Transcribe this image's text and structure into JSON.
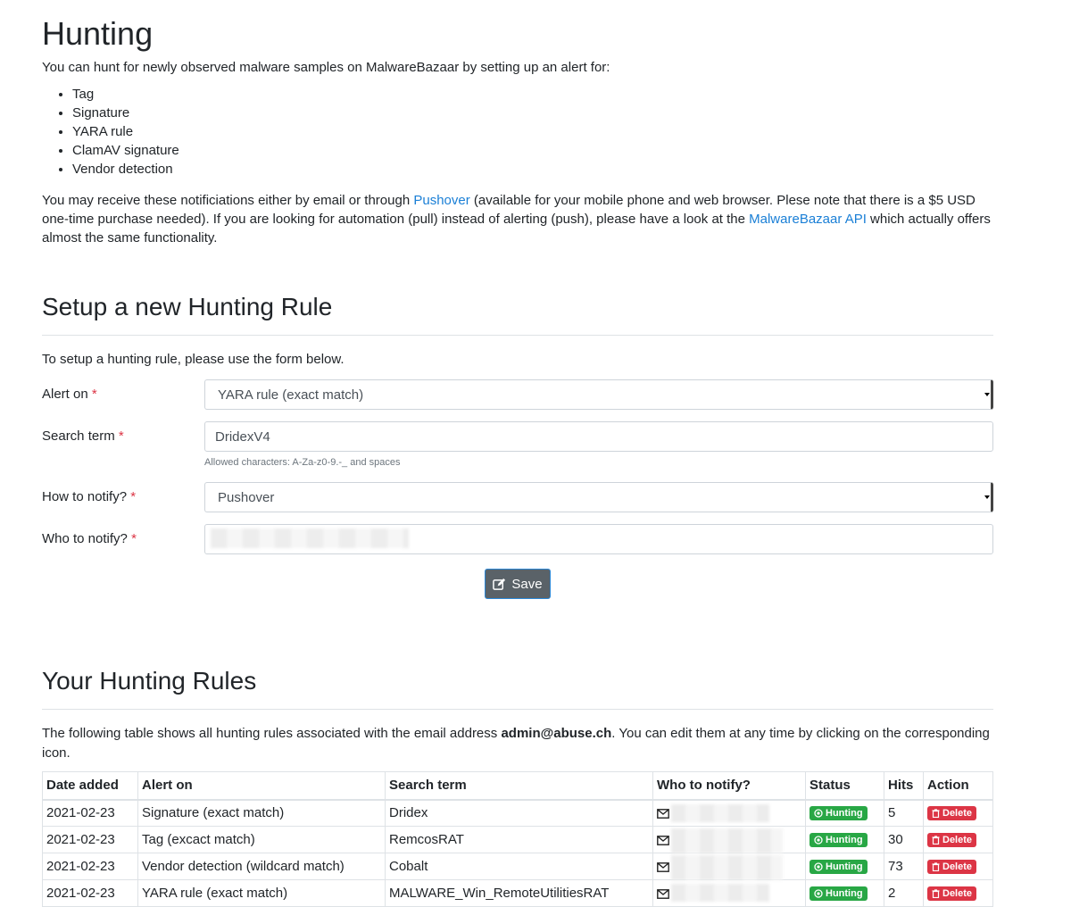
{
  "page": {
    "title": "Hunting",
    "intro": "You can hunt for newly observed malware samples on MalwareBazaar by setting up an alert for:",
    "alert_types": [
      "Tag",
      "Signature",
      "YARA rule",
      "ClamAV signature",
      "Vendor detection"
    ],
    "notify_para": {
      "part1": "You may receive these notificiations either by email or through ",
      "pushover_link": "Pushover",
      "part2": " (available for your mobile phone and web browser. Plese note that there is a $5 USD one-time purchase needed). If you are looking for automation (pull) instead of alerting (push), please have a look at the ",
      "api_link": "MalwareBazaar API",
      "part3": " which actually offers almost the same functionality."
    }
  },
  "setup": {
    "title": "Setup a new Hunting Rule",
    "subtitle": "To setup a hunting rule, please use the form below.",
    "alert_on_label": "Alert on ",
    "alert_on_value": "YARA rule (exact match)",
    "search_term_label": "Search term ",
    "search_term_value": "DridexV4",
    "search_term_help": "Allowed characters: A-Za-z0-9.-_ and spaces",
    "how_label": "How to notify? ",
    "how_value": "Pushover",
    "who_label": "Who to notify? ",
    "required_mark": "*",
    "save_label": "Save"
  },
  "rules": {
    "title": "Your Hunting Rules",
    "desc_part1": "The following table shows all hunting rules associated with the email address ",
    "email": "admin@abuse.ch",
    "desc_part2": ". You can edit them at any time by clicking on the corresponding icon.",
    "columns": [
      "Date added",
      "Alert on",
      "Search term",
      "Who to notify?",
      "Status",
      "Hits",
      "Action"
    ],
    "status_label": "Hunting",
    "delete_label": "Delete",
    "rows": [
      {
        "date": "2021-02-23",
        "alert_on": "Signature (exact match)",
        "term": "Dridex",
        "hits": "5"
      },
      {
        "date": "2021-02-23",
        "alert_on": "Tag (excact match)",
        "term": "RemcosRAT",
        "hits": "30"
      },
      {
        "date": "2021-02-23",
        "alert_on": "Vendor detection (wildcard match)",
        "term": "Cobalt",
        "hits": "73"
      },
      {
        "date": "2021-02-23",
        "alert_on": "YARA rule (exact match)",
        "term": "MALWARE_Win_RemoteUtilitiesRAT",
        "hits": "2"
      }
    ]
  },
  "colors": {
    "link": "#1a7fd6",
    "required": "#dc3545",
    "badge_green": "#28a745",
    "badge_red": "#dc3545",
    "save_bg": "#5a6268"
  }
}
